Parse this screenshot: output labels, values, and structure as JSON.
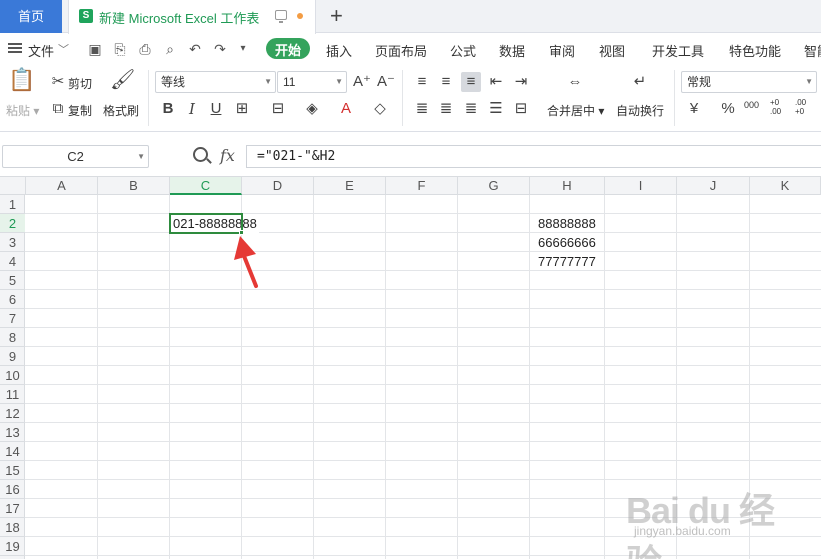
{
  "tabs": {
    "home": "首页",
    "doc_title": "新建 Microsoft Excel 工作表",
    "doc_icon": "S",
    "new_tab": "+"
  },
  "menu": {
    "file": "文件",
    "items": [
      "开始",
      "插入",
      "页面布局",
      "公式",
      "数据",
      "审阅",
      "视图",
      "开发工具",
      "特色功能",
      "智能"
    ]
  },
  "ribbon": {
    "paste": "粘贴",
    "cut": "剪切",
    "copy": "复制",
    "format_painter": "格式刷",
    "font_name": "等线",
    "font_size": "11",
    "merge_center": "合并居中",
    "wrap_text": "自动换行",
    "number_format": "常规",
    "percent": "%",
    "thousands": "000",
    "inc_decimal": "+0 .00",
    "dec_decimal": ".00 +0"
  },
  "formula_bar": {
    "name_box": "C2",
    "fx": "fx",
    "formula": "=\"021-\"&H2"
  },
  "grid": {
    "columns": [
      "A",
      "B",
      "C",
      "D",
      "E",
      "F",
      "G",
      "H",
      "I",
      "J",
      "K"
    ],
    "rows": [
      "1",
      "2",
      "3",
      "4",
      "5",
      "6",
      "7",
      "8",
      "9",
      "10",
      "11",
      "12",
      "13",
      "14",
      "15",
      "16",
      "17",
      "18",
      "19"
    ],
    "selected_column": "C",
    "selected_row": "2",
    "cells": {
      "C2": "021-88888888",
      "H2": "88888888",
      "H3": "66666666",
      "H4": "77777777"
    }
  },
  "watermark": {
    "logo": "Bai du 经验",
    "url": "jingyan.baidu.com"
  },
  "colors": {
    "accent_green": "#34a35c",
    "home_blue": "#3a79d8",
    "arrow_red": "#e53935"
  }
}
